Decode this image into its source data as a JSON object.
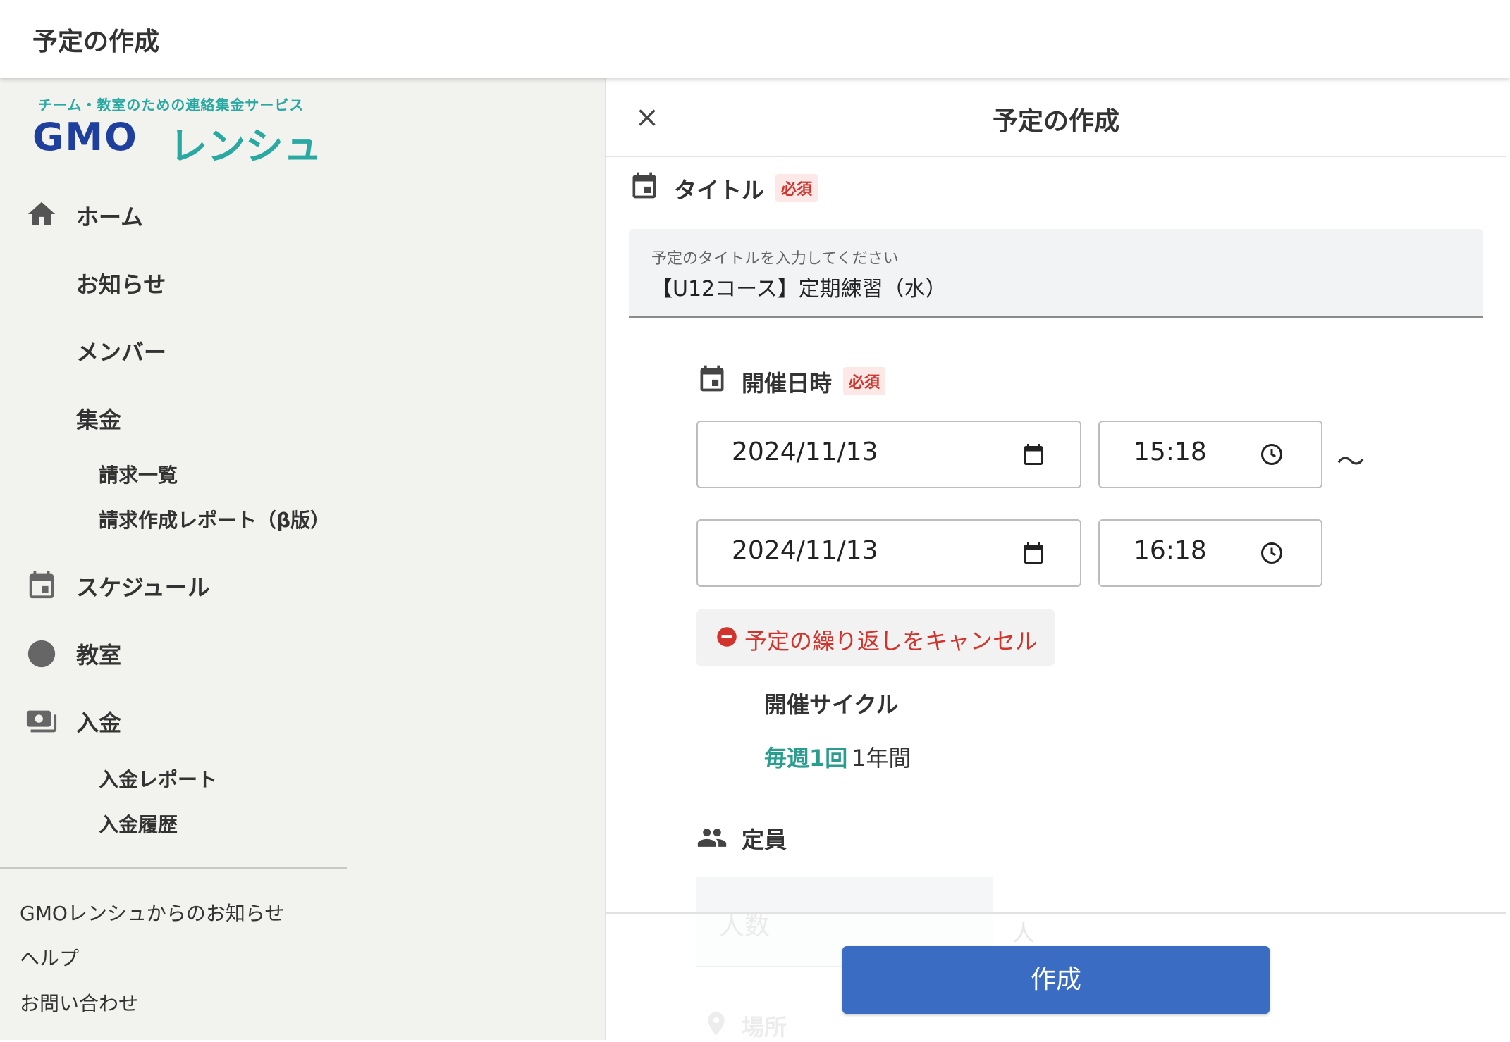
{
  "app": {
    "header_title": "予定の作成"
  },
  "brand": {
    "tagline": "チーム・教室のための連絡集金サービス",
    "logo_gmo": "GMO",
    "logo_kana": "レンシュ"
  },
  "sidebar": {
    "items": [
      {
        "label": "ホーム",
        "icon": "home-icon"
      },
      {
        "label": "お知らせ"
      },
      {
        "label": "メンバー"
      },
      {
        "label": "集金"
      },
      {
        "label": "請求一覧"
      },
      {
        "label": "請求作成レポート（β版）"
      },
      {
        "label": "スケジュール",
        "icon": "calendar-icon"
      },
      {
        "label": "教室",
        "icon": "circle-icon"
      },
      {
        "label": "入金",
        "icon": "payment-icon"
      },
      {
        "label": "入金レポート"
      },
      {
        "label": "入金履歴"
      }
    ],
    "footer_links": [
      "GMOレンシュからのお知らせ",
      "ヘルプ",
      "お問い合わせ"
    ]
  },
  "panel": {
    "title": "予定の作成",
    "title_section": {
      "label": "タイトル",
      "required": "必須",
      "field_label": "予定のタイトルを入力してください",
      "value": "【U12コース】定期練習（水）"
    },
    "datetime_section": {
      "label": "開催日時",
      "required": "必須",
      "start_date": "2024/11/13",
      "start_time": "15:18",
      "separator": "～",
      "end_date": "2024/11/13",
      "end_time": "16:18"
    },
    "cancel_repeat_label": "予定の繰り返しをキャンセル",
    "cycle": {
      "label": "開催サイクル",
      "frequency": "毎週1回",
      "duration": "1年間"
    },
    "capacity": {
      "label": "定員",
      "placeholder": "人数",
      "unit": "人"
    },
    "place": {
      "label": "場所"
    },
    "create_button": "作成"
  },
  "colors": {
    "primary": "#3a6cc4",
    "teal": "#2a9d8f",
    "danger": "#d0342c",
    "logo_navy": "#1f3f9e"
  }
}
